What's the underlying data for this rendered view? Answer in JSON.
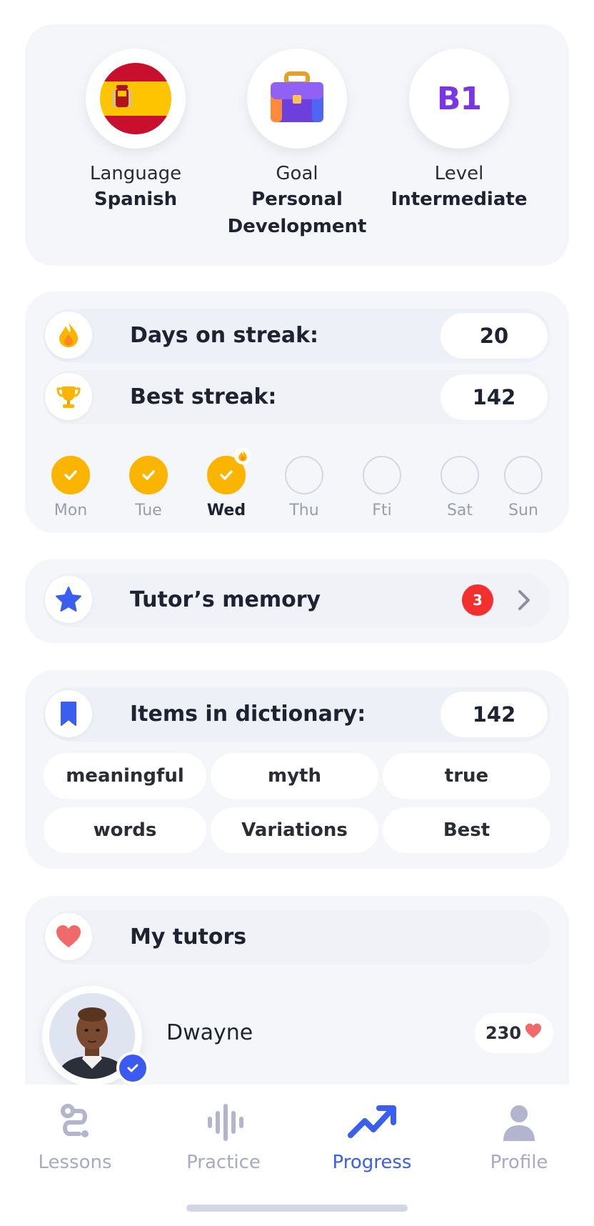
{
  "profile": {
    "language": {
      "title": "Language",
      "value": "Spanish",
      "icon": "spain-flag-icon"
    },
    "goal": {
      "title": "Goal",
      "value_line1": "Personal",
      "value_line2": "Development",
      "icon": "briefcase-icon"
    },
    "level": {
      "title": "Level",
      "value": "Intermediate",
      "badge": "B1"
    }
  },
  "streak": {
    "days_label": "Days on streak:",
    "days_value": "20",
    "best_label": "Best streak:",
    "best_value": "142",
    "week": [
      {
        "label": "Mon",
        "done": true
      },
      {
        "label": "Tue",
        "done": true
      },
      {
        "label": "Wed",
        "done": true,
        "today": true
      },
      {
        "label": "Thu",
        "done": false
      },
      {
        "label": "Fti",
        "done": false
      },
      {
        "label": "Sat",
        "done": false
      },
      {
        "label": "Sun",
        "done": false
      }
    ]
  },
  "memory": {
    "label": "Tutor’s memory",
    "badge": "3"
  },
  "dictionary": {
    "label": "Items in dictionary:",
    "count": "142",
    "words": [
      "meaningful",
      "myth",
      "true",
      "words",
      "Variations",
      "Best"
    ]
  },
  "tutors": {
    "label": "My tutors",
    "list": [
      {
        "name": "Dwayne",
        "likes": "230"
      }
    ]
  },
  "nav": {
    "items": [
      {
        "label": "Lessons",
        "icon": "path-icon",
        "active": false
      },
      {
        "label": "Practice",
        "icon": "soundwave-icon",
        "active": false
      },
      {
        "label": "Progress",
        "icon": "trending-up-icon",
        "active": true
      },
      {
        "label": "Profile",
        "icon": "person-icon",
        "active": false
      }
    ]
  },
  "colors": {
    "accent": "#3a5ef0",
    "streak_yellow": "#fbb500",
    "badge_red": "#f2302e",
    "level_purple": "#7a36e6",
    "card_bg": "#f5f6fa"
  }
}
